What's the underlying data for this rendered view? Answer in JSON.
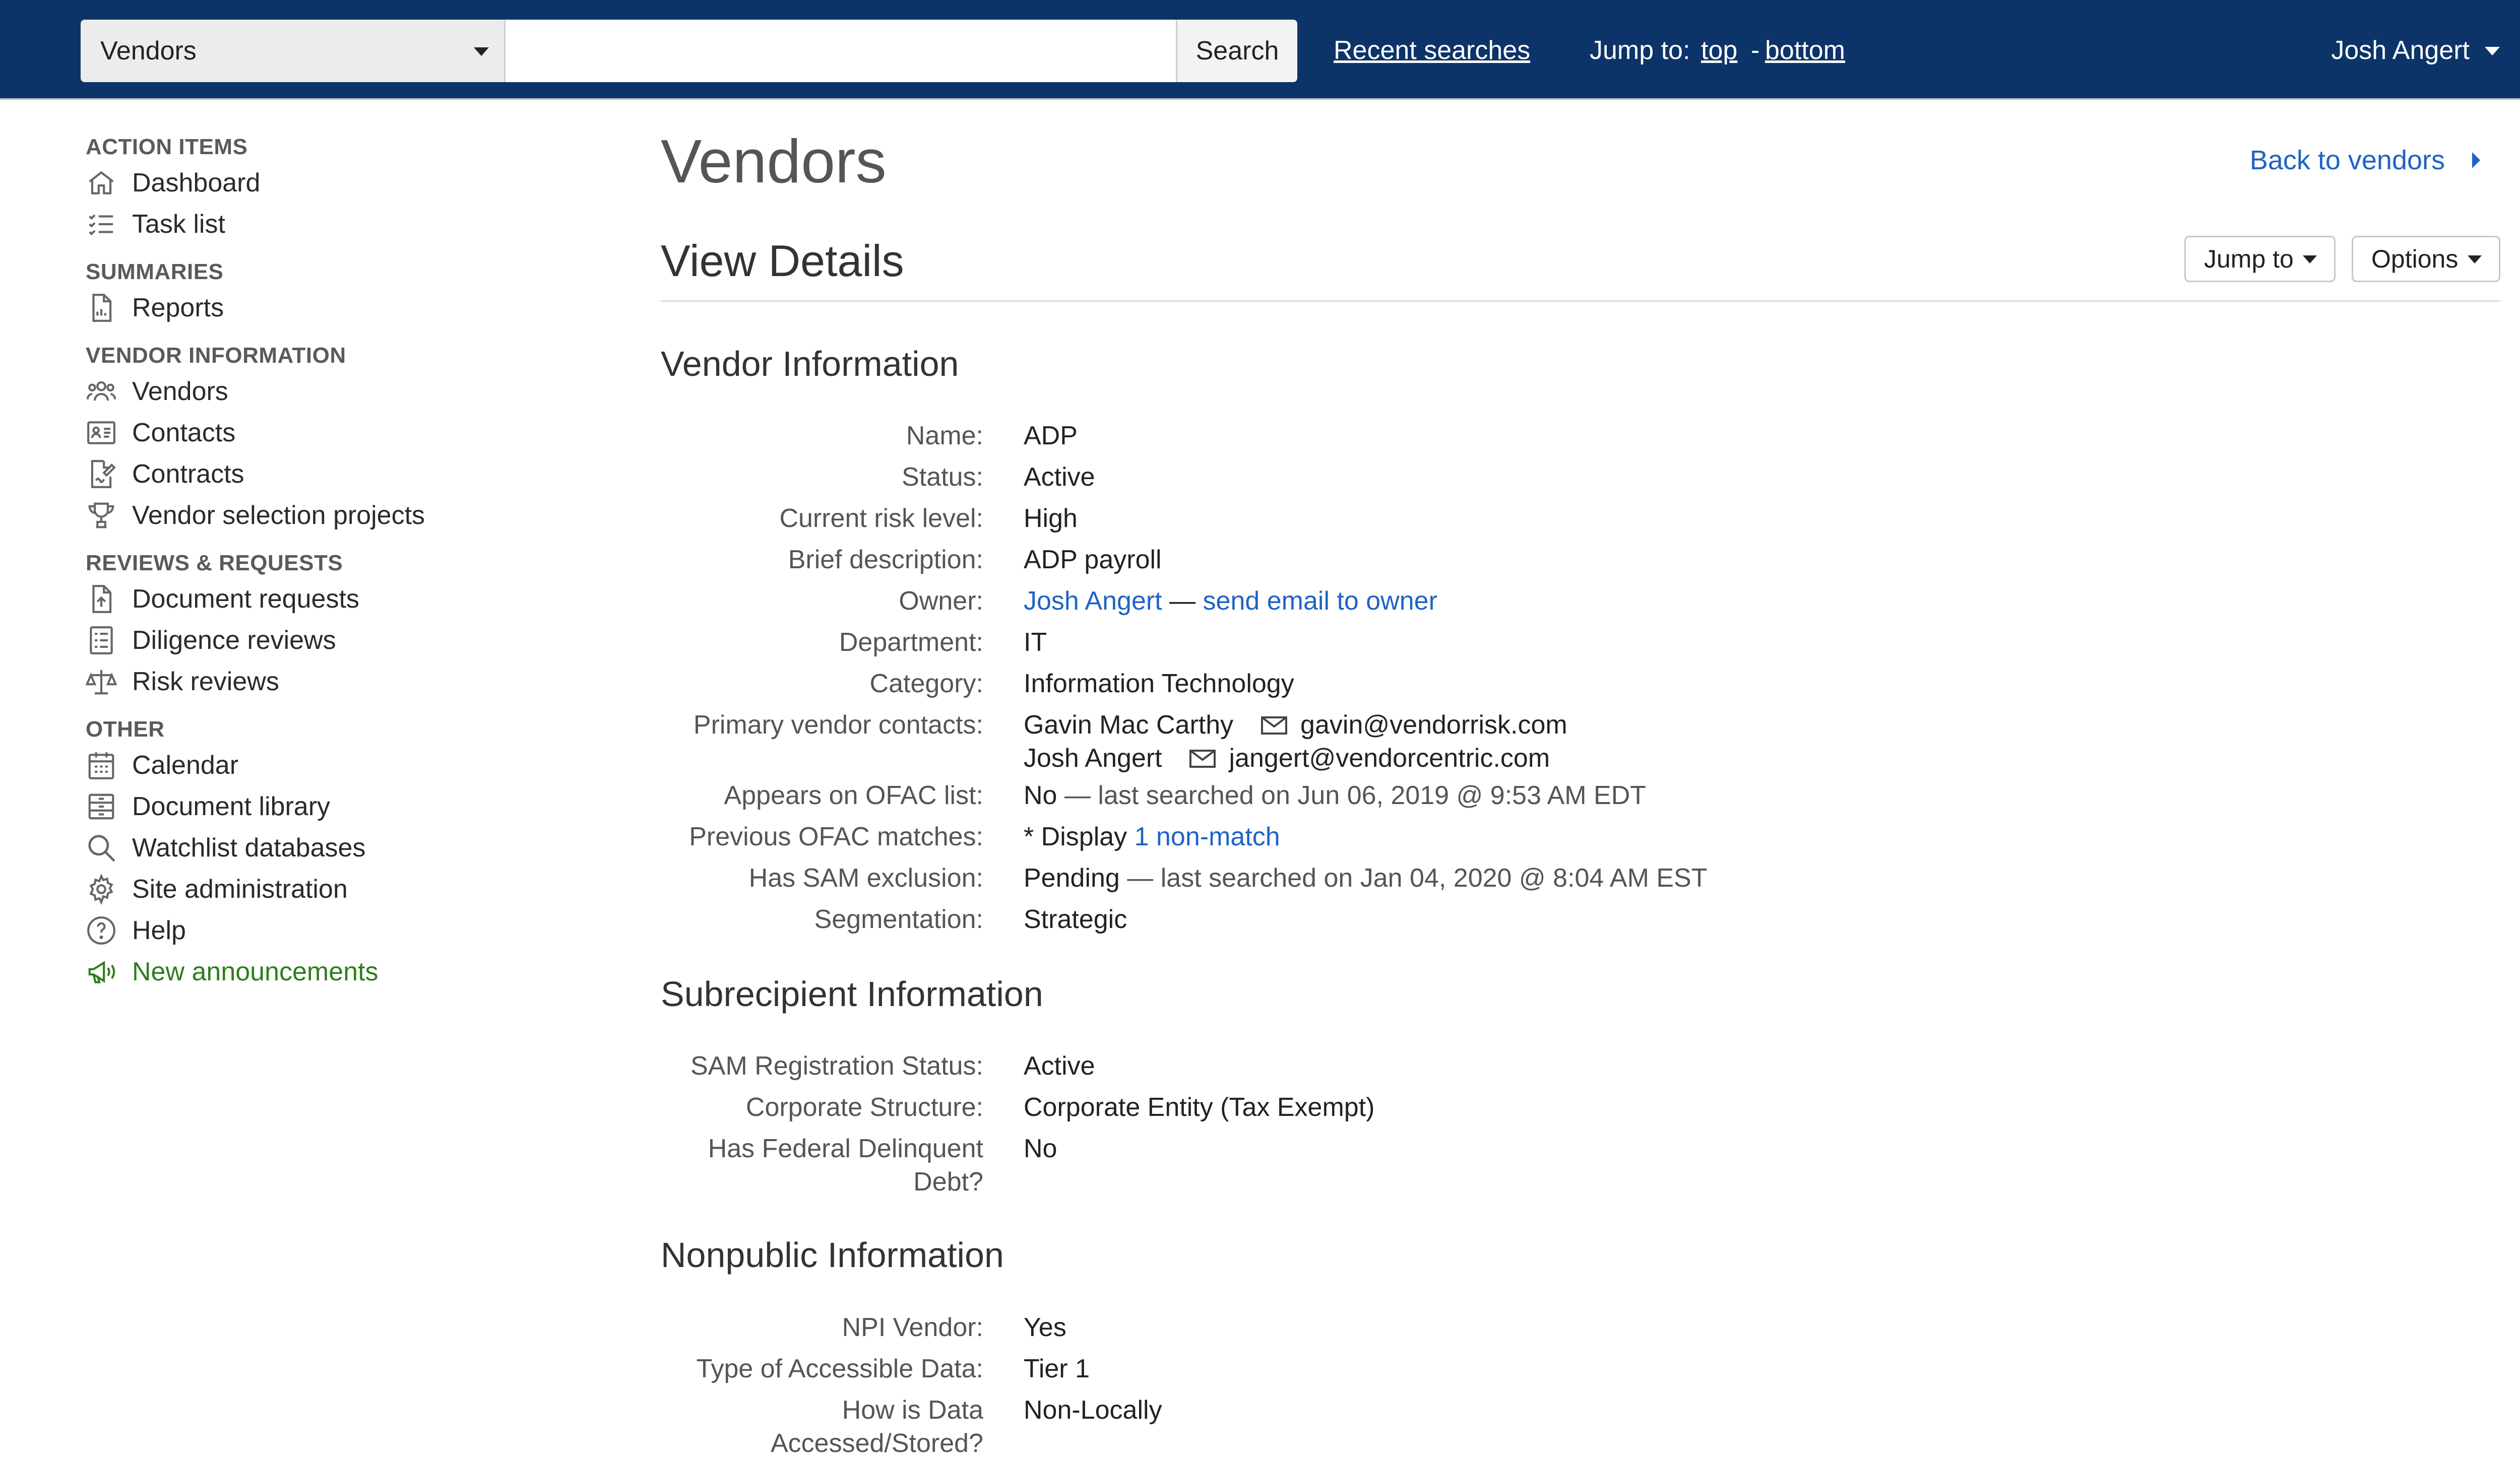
{
  "topbar": {
    "scope_select": "Vendors",
    "search_placeholder": "",
    "search_button": "Search",
    "recent_searches": "Recent searches",
    "jump_to_label": "Jump to:",
    "jump_top": "top",
    "jump_separator": "-",
    "jump_bottom": "bottom",
    "user_name": "Josh Angert",
    "background_color": "#0d3469"
  },
  "sidebar": {
    "sections": [
      {
        "title": "ACTION ITEMS",
        "items": [
          {
            "label": "Dashboard",
            "icon": "home-icon"
          },
          {
            "label": "Task list",
            "icon": "task-list-icon"
          }
        ]
      },
      {
        "title": "SUMMARIES",
        "items": [
          {
            "label": "Reports",
            "icon": "report-icon"
          }
        ]
      },
      {
        "title": "VENDOR INFORMATION",
        "items": [
          {
            "label": "Vendors",
            "icon": "users-icon"
          },
          {
            "label": "Contacts",
            "icon": "address-card-icon"
          },
          {
            "label": "Contracts",
            "icon": "contract-signature-icon"
          },
          {
            "label": "Vendor selection projects",
            "icon": "trophy-icon"
          }
        ]
      },
      {
        "title": "REVIEWS & REQUESTS",
        "items": [
          {
            "label": "Document requests",
            "icon": "file-upload-icon"
          },
          {
            "label": "Diligence reviews",
            "icon": "checklist-icon"
          },
          {
            "label": "Risk reviews",
            "icon": "balance-scale-icon"
          }
        ]
      },
      {
        "title": "OTHER",
        "items": [
          {
            "label": "Calendar",
            "icon": "calendar-icon"
          },
          {
            "label": "Document library",
            "icon": "archive-icon"
          },
          {
            "label": "Watchlist databases",
            "icon": "search-icon"
          },
          {
            "label": "Site administration",
            "icon": "gear-icon"
          },
          {
            "label": "Help",
            "icon": "question-circle-icon"
          },
          {
            "label": "New announcements",
            "icon": "megaphone-icon",
            "color": "#2e7d1c"
          }
        ]
      }
    ]
  },
  "main": {
    "page_title": "Vendors",
    "back_link": "Back to vendors",
    "view_title": "View Details",
    "jump_to_button": "Jump to",
    "options_button": "Options",
    "vendor_info": {
      "title": "Vendor Information",
      "name_label": "Name:",
      "name": "ADP",
      "status_label": "Status:",
      "status": "Active",
      "risk_label": "Current risk level:",
      "risk": "High",
      "desc_label": "Brief description:",
      "desc": "ADP payroll",
      "owner_label": "Owner:",
      "owner": "Josh Angert",
      "owner_sep": "—",
      "owner_email_link": "send email to owner",
      "dept_label": "Department:",
      "dept": "IT",
      "category_label": "Category:",
      "category": "Information Technology",
      "contacts_label": "Primary vendor contacts:",
      "contacts": [
        {
          "name": "Gavin Mac Carthy",
          "email": "gavin@vendorrisk.com"
        },
        {
          "name": "Josh Angert",
          "email": "jangert@vendorcentric.com"
        }
      ],
      "ofac_label": "Appears on OFAC list:",
      "ofac": "No",
      "ofac_note": "— last searched on Jun 06, 2019 @ 9:53 AM EDT",
      "prev_ofac_label": "Previous OFAC matches:",
      "prev_ofac_prefix": "* Display",
      "prev_ofac_link": "1 non-match",
      "sam_label": "Has SAM exclusion:",
      "sam": "Pending",
      "sam_note": "— last searched on Jan 04, 2020 @ 8:04 AM EST",
      "seg_label": "Segmentation:",
      "seg": "Strategic"
    },
    "subrecipient": {
      "title": "Subrecipient Information",
      "sam_reg_label": "SAM Registration Status:",
      "sam_reg": "Active",
      "corp_label": "Corporate Structure:",
      "corp": "Corporate Entity (Tax Exempt)",
      "debt_label_1": "Has Federal Delinquent",
      "debt_label_2": "Debt?",
      "debt": "No"
    },
    "nonpublic": {
      "title": "Nonpublic Information",
      "npi_label": "NPI Vendor:",
      "npi": "Yes",
      "data_type_label": "Type of Accessible Data:",
      "data_type": "Tier 1",
      "accessed_label_1": "How is Data",
      "accessed_label_2": "Accessed/Stored?",
      "accessed": "Non-Locally"
    }
  }
}
